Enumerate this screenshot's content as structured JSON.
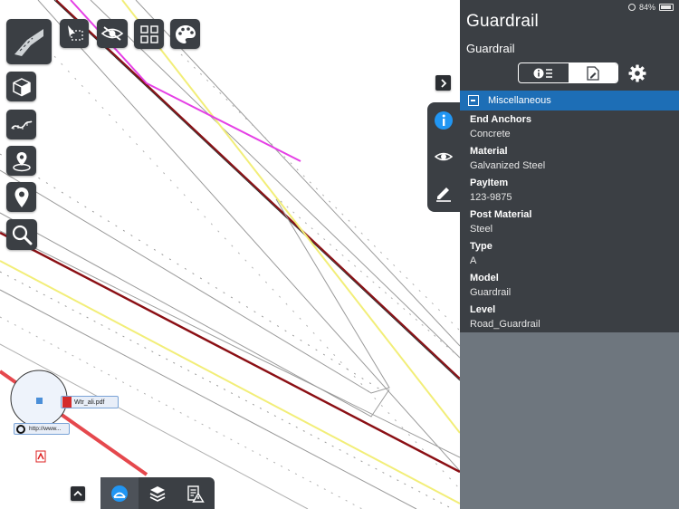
{
  "status": {
    "battery": "84%"
  },
  "panel": {
    "title": "Guardrail",
    "subtitle": "Guardrail",
    "segments": [
      {
        "icon": "info-list-icon",
        "active": false
      },
      {
        "icon": "document-edit-icon",
        "active": true
      }
    ],
    "section": "Miscellaneous",
    "properties": [
      {
        "key": "End Anchors",
        "value": "Concrete"
      },
      {
        "key": "Material",
        "value": "Galvanized Steel"
      },
      {
        "key": "PayItem",
        "value": "123-9875"
      },
      {
        "key": "Post Material",
        "value": "Steel"
      },
      {
        "key": "Type",
        "value": "A"
      },
      {
        "key": "Model",
        "value": "Guardrail"
      },
      {
        "key": "Level",
        "value": "Road_Guardrail"
      }
    ]
  },
  "map": {
    "attachments": [
      {
        "name": "pdf-attachment",
        "label": "Wtr_ali.pdf"
      },
      {
        "name": "link-attachment",
        "label": "http://www..."
      }
    ]
  },
  "colors": {
    "panel_bg": "#3b3f44",
    "section_header": "#1d6eb6",
    "accent_blue": "#2196f3",
    "road_yellow": "#f2ee78",
    "road_dark_red": "#8b0f14",
    "magenta": "#e53fe5"
  }
}
